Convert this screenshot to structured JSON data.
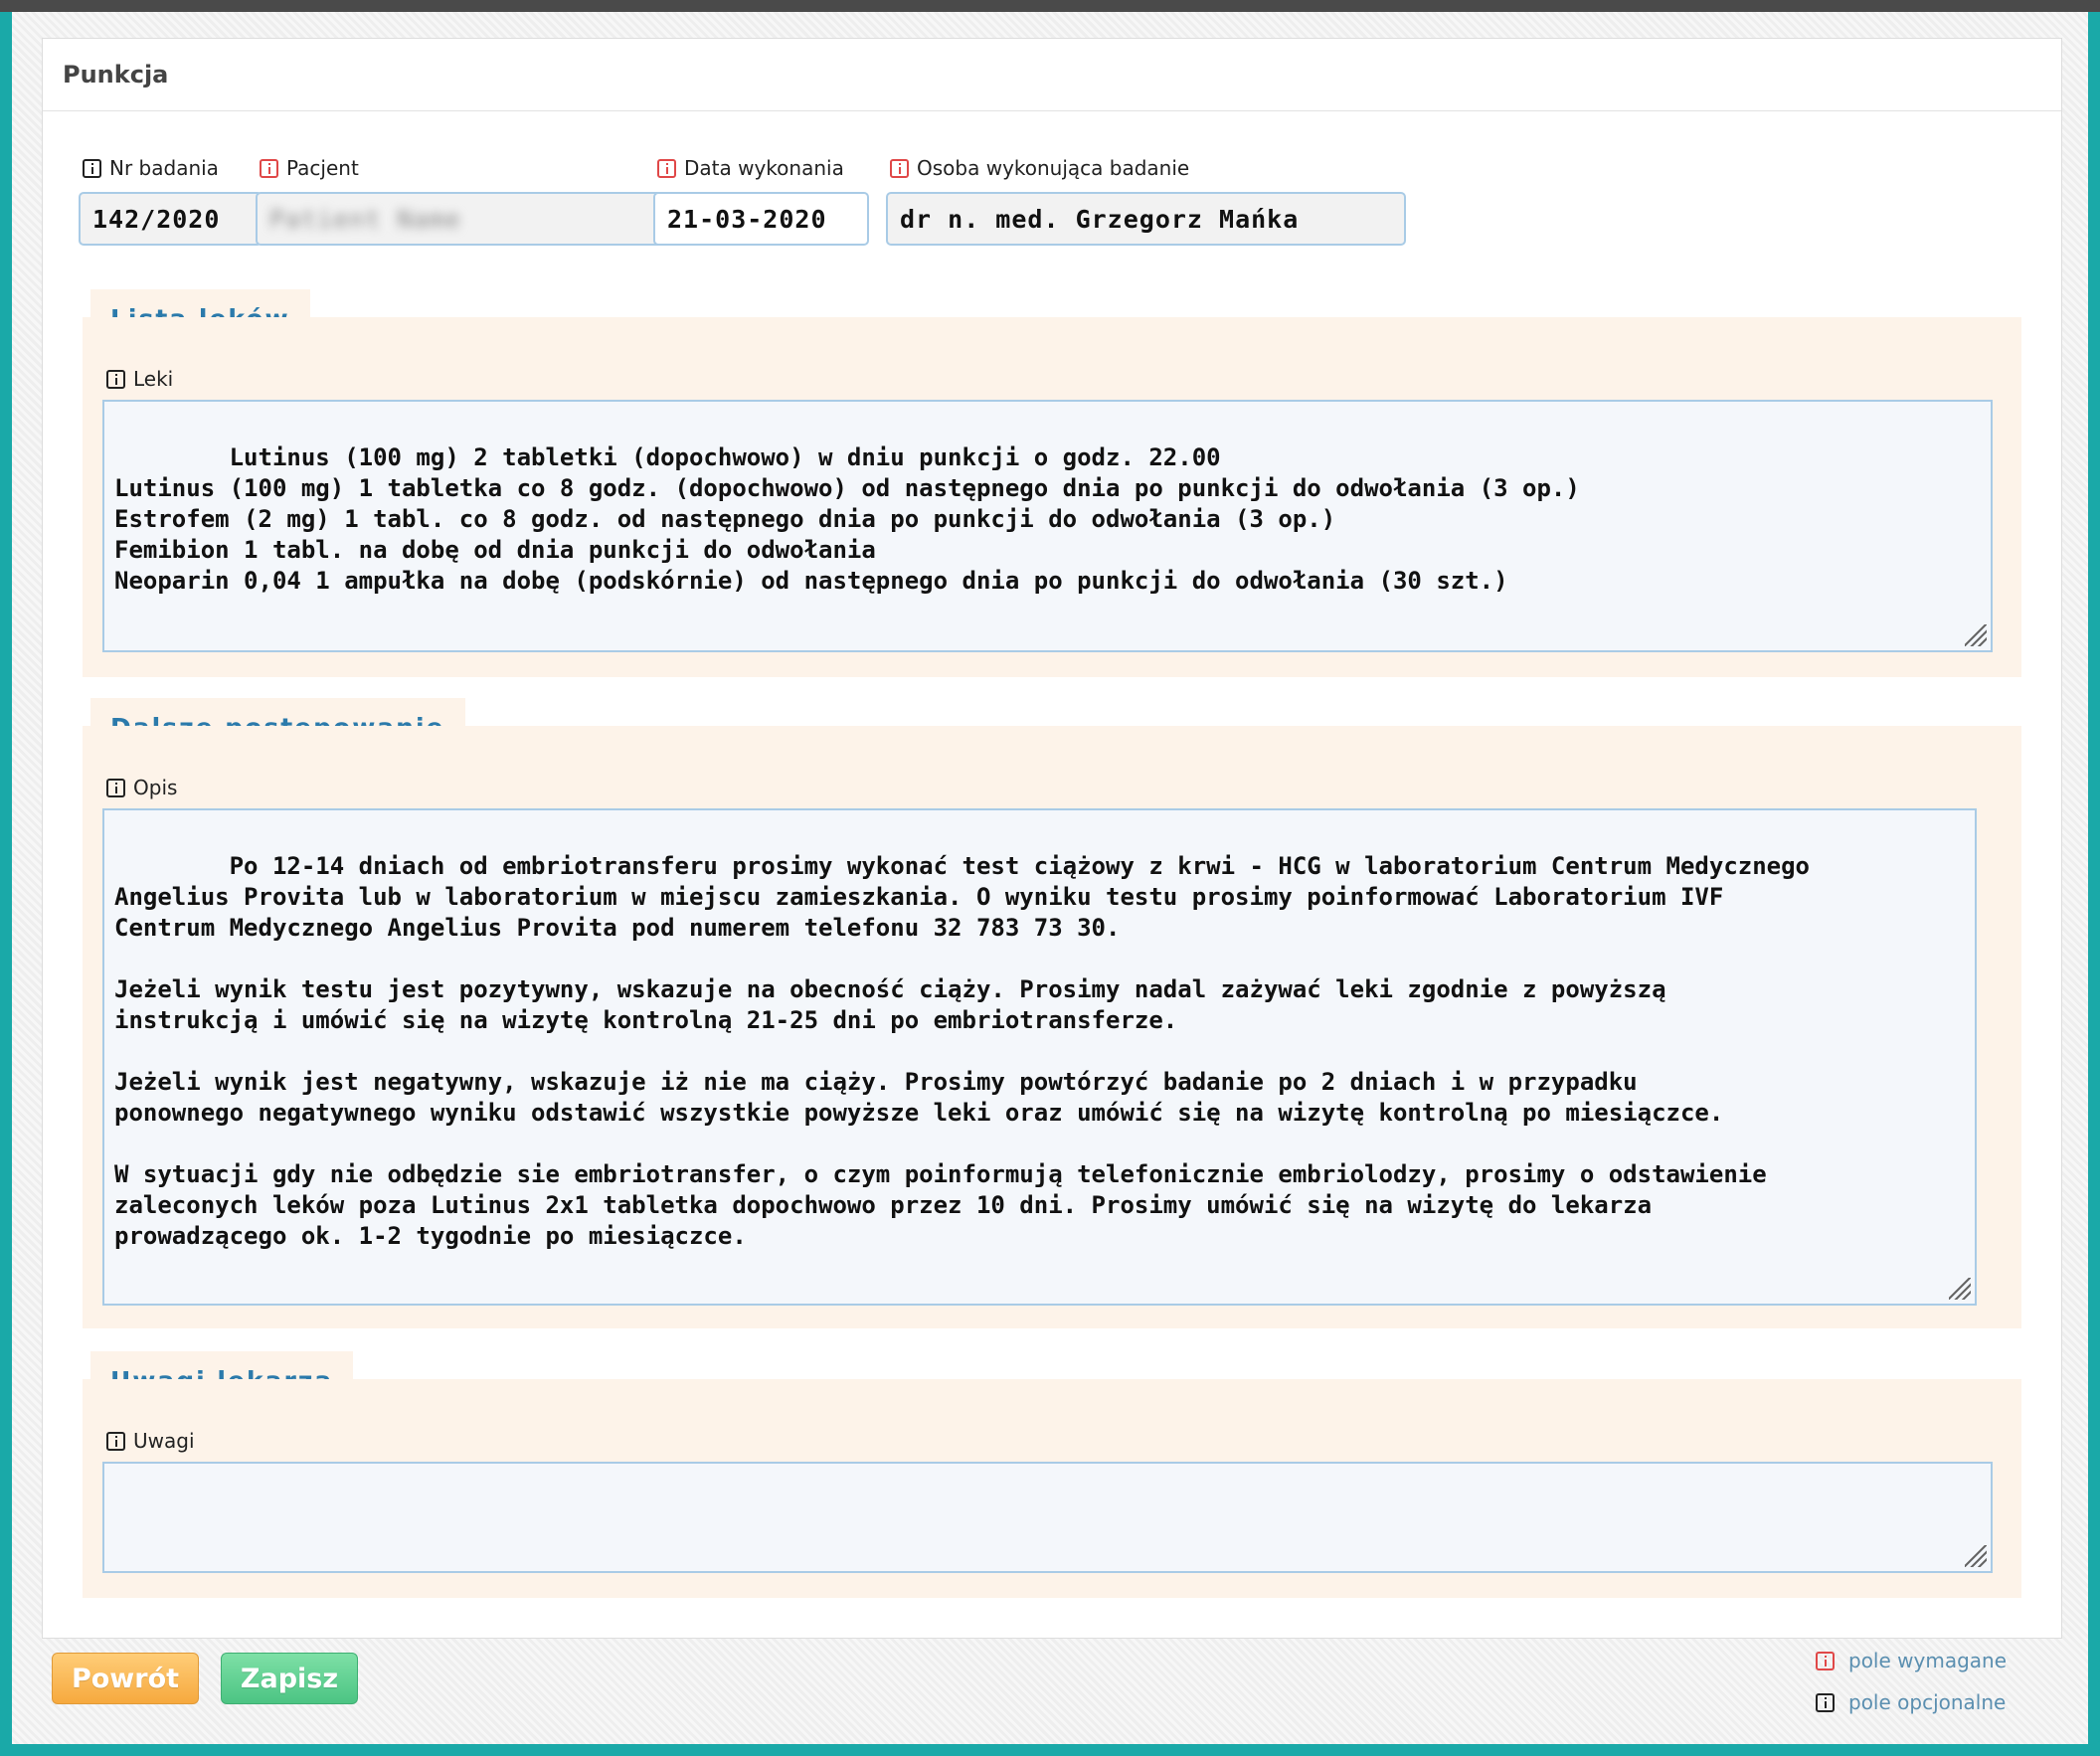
{
  "panel": {
    "title": "Punkcja"
  },
  "fields": {
    "nr_badania": {
      "label": "Nr badania",
      "value": "142/2020"
    },
    "pacjent": {
      "label": "Pacjent",
      "value": "Patient Name"
    },
    "data_wykonania": {
      "label": "Data wykonania",
      "value": "21-03-2020"
    },
    "osoba": {
      "label": "Osoba wykonująca badanie",
      "value": "dr n. med. Grzegorz Mańka"
    }
  },
  "sections": {
    "leki": {
      "title": "Lista leków",
      "field_label": "Leki",
      "value": "Lutinus (100 mg) 2 tabletki (dopochwowo) w dniu punkcji o godz. 22.00\nLutinus (100 mg) 1 tabletka co 8 godz. (dopochwowo) od następnego dnia po punkcji do odwołania (3 op.)\nEstrofem (2 mg) 1 tabl. co 8 godz. od następnego dnia po punkcji do odwołania (3 op.)\nFemibion 1 tabl. na dobę od dnia punkcji do odwołania\nNeoparin 0,04 1 ampułka na dobę (podskórnie) od następnego dnia po punkcji do odwołania (30 szt.)"
    },
    "dalsze": {
      "title": "Dalsze postępowanie",
      "field_label": "Opis",
      "value": "Po 12-14 dniach od embriotransferu prosimy wykonać test ciążowy z krwi - HCG w laboratorium Centrum Medycznego\nAngelius Provita lub w laboratorium w miejscu zamieszkania. O wyniku testu prosimy poinformować Laboratorium IVF\nCentrum Medycznego Angelius Provita pod numerem telefonu 32 783 73 30.\n\nJeżeli wynik testu jest pozytywny, wskazuje na obecność ciąży. Prosimy nadal zażywać leki zgodnie z powyższą\ninstrukcją i umówić się na wizytę kontrolną 21-25 dni po embriotransferze.\n\nJeżeli wynik jest negatywny, wskazuje iż nie ma ciąży. Prosimy powtórzyć badanie po 2 dniach i w przypadku\nponownego negatywnego wyniku odstawić wszystkie powyższe leki oraz umówić się na wizytę kontrolną po miesiączce.\n\nW sytuacji gdy nie odbędzie sie embriotransfer, o czym poinformują telefonicznie embriolodzy, prosimy o odstawienie\nzaleconych leków poza Lutinus 2x1 tabletka dopochwowo przez 10 dni. Prosimy umówić się na wizytę do lekarza\nprowadzącego ok. 1-2 tygodnie po miesiączce."
    },
    "uwagi": {
      "title": "Uwagi lekarza",
      "field_label": "Uwagi",
      "value": ""
    }
  },
  "buttons": {
    "back": "Powrót",
    "save": "Zapisz"
  },
  "legend": {
    "required": "pole wymagane",
    "optional": "pole opcjonalne"
  },
  "colors": {
    "frame_accent": "#1aa9a8",
    "section_bg": "#fdf3e9",
    "section_title": "#2b7aab",
    "required_icon": "#e04848",
    "back_button": "#f6a93e",
    "save_button": "#4cc483"
  }
}
